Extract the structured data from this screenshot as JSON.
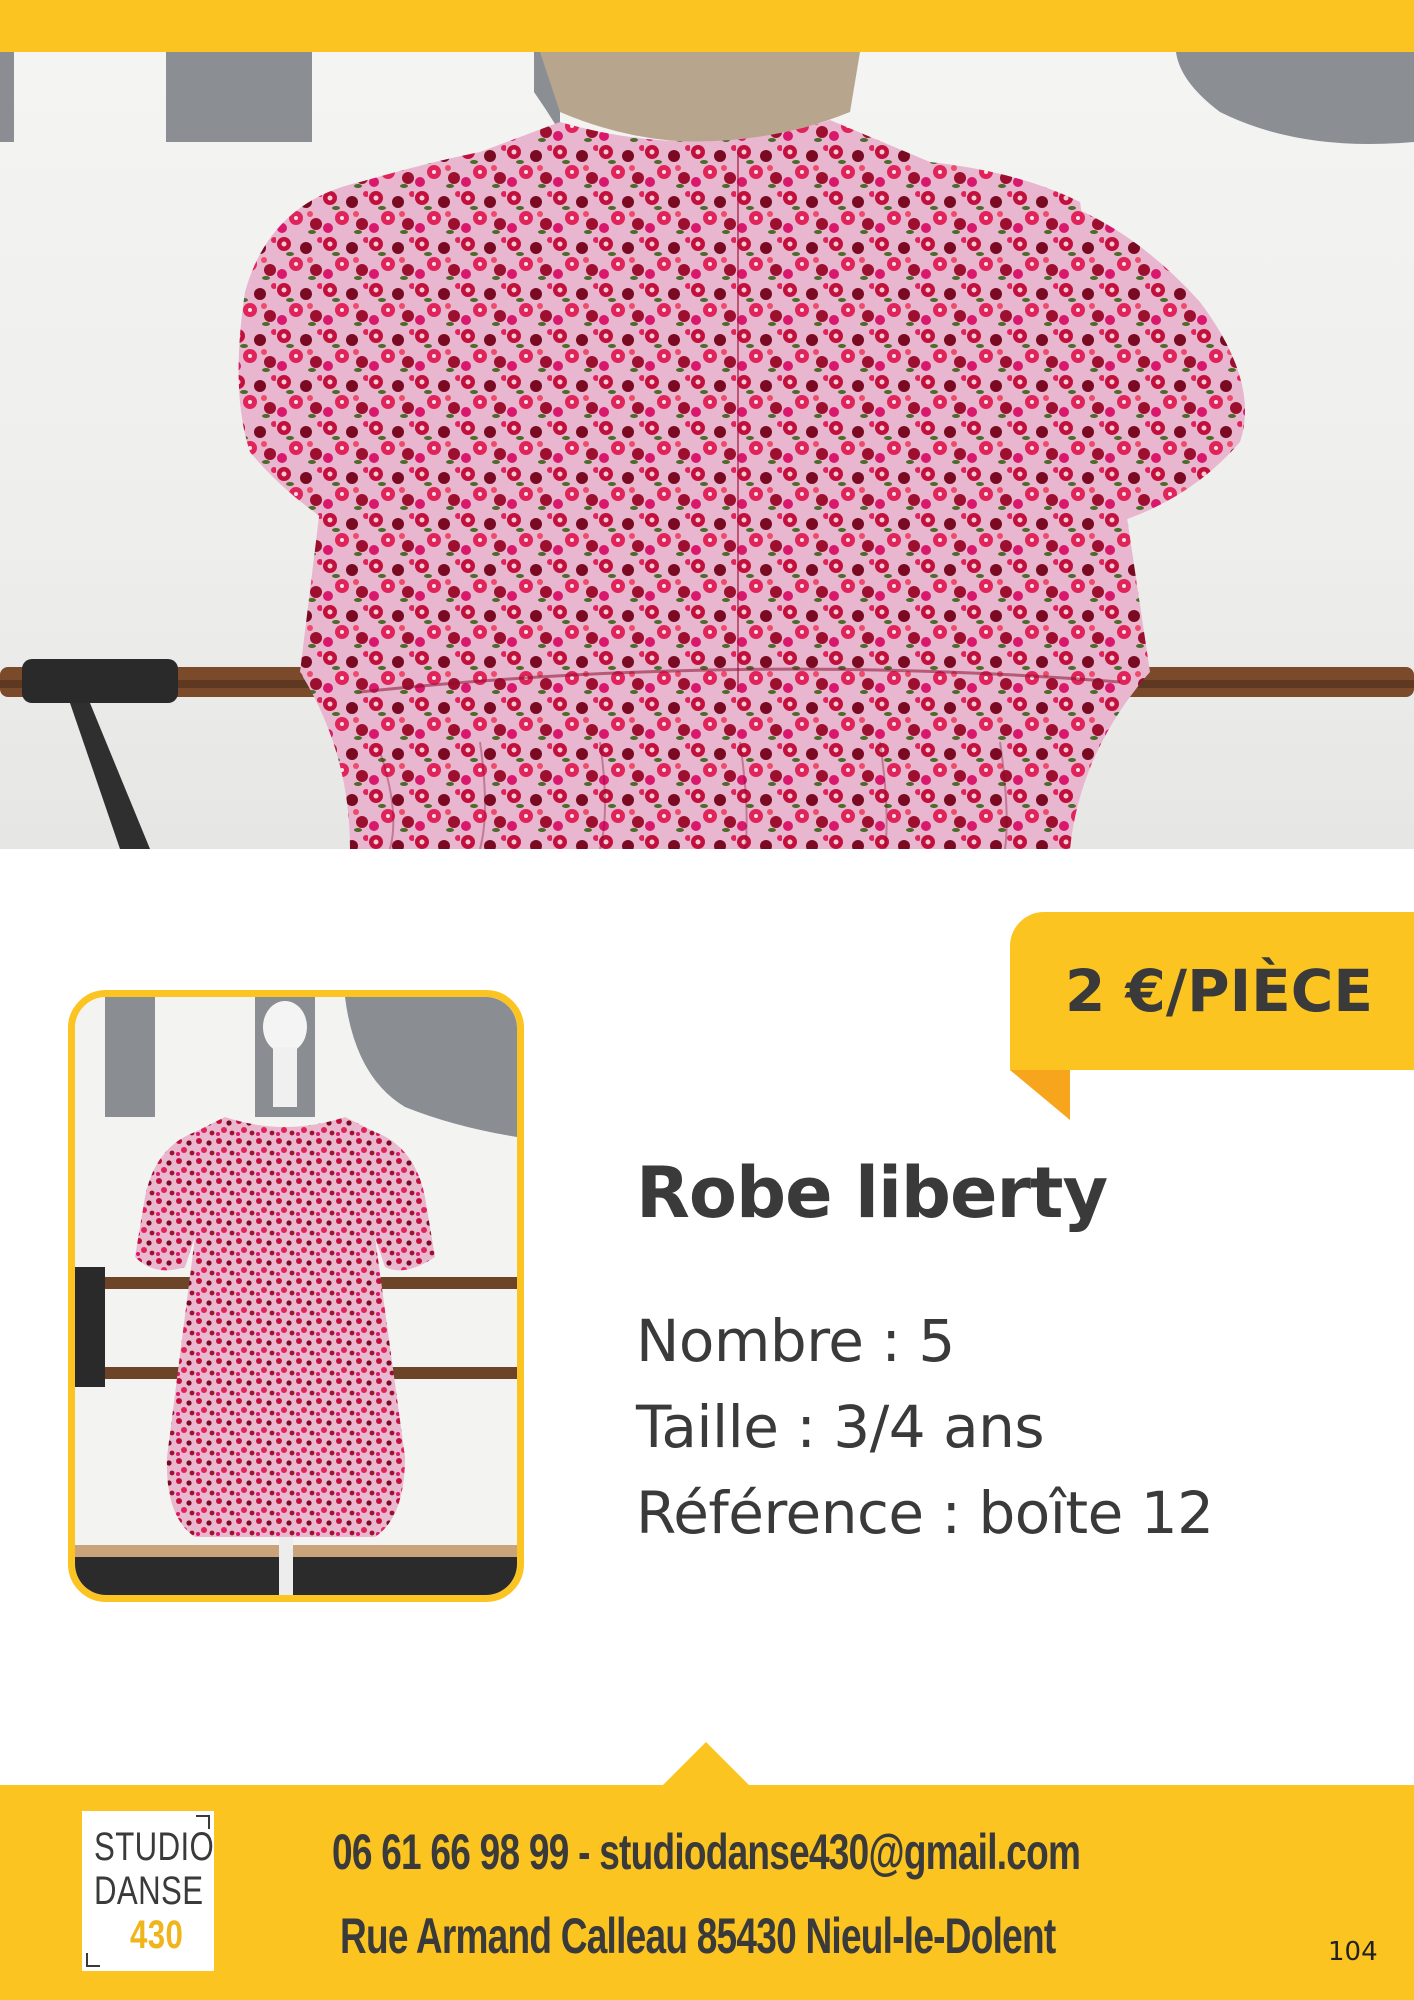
{
  "price": {
    "label": "2 €/PIÈCE"
  },
  "product": {
    "title": "Robe liberty",
    "details": [
      "Nombre : 5",
      "Taille : 3/4 ans",
      "Référence : boîte 12"
    ]
  },
  "footer": {
    "logo": {
      "line1": "STUDIO",
      "line2": "DANSE",
      "line3": "430"
    },
    "contact_line_1": "06 61 66 98 99 - studiodanse430@gmail.com",
    "contact_line_2": "Rue Armand Calleau 85430 Nieul-le-Dolent",
    "page_number": "104"
  },
  "colors": {
    "accent_yellow": "#fbc421",
    "accent_orange": "#f7a51d",
    "text_dark": "#3a3a3a"
  },
  "images": {
    "hero": "photo-floral-dress-back-closeup",
    "thumbnail": "photo-floral-dress-on-mannequin"
  }
}
